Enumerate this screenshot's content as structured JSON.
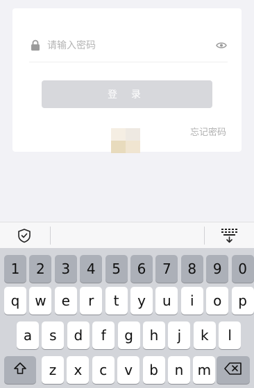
{
  "login": {
    "password_placeholder": "请输入密码",
    "login_button": "登 录",
    "forgot_password": "忘记密码"
  },
  "keyboard": {
    "row_numbers": [
      "1",
      "2",
      "3",
      "4",
      "5",
      "6",
      "7",
      "8",
      "9",
      "0"
    ],
    "row_top": [
      "q",
      "w",
      "e",
      "r",
      "t",
      "y",
      "u",
      "i",
      "o",
      "p"
    ],
    "row_middle": [
      "a",
      "s",
      "d",
      "f",
      "g",
      "h",
      "j",
      "k",
      "l"
    ],
    "row_bottom": [
      "z",
      "x",
      "c",
      "v",
      "b",
      "n",
      "m"
    ]
  },
  "icons": {
    "lock": "lock-icon",
    "eye": "eye-icon",
    "shield": "shield-icon",
    "keyboard_collapse": "keyboard-collapse-icon",
    "shift": "shift-icon",
    "backspace": "backspace-icon"
  },
  "colors": {
    "background": "#f2f2f6",
    "button_disabled": "#d7d8dc",
    "keyboard_bg": "#d3d5da",
    "key_dark": "#acb0b8"
  }
}
